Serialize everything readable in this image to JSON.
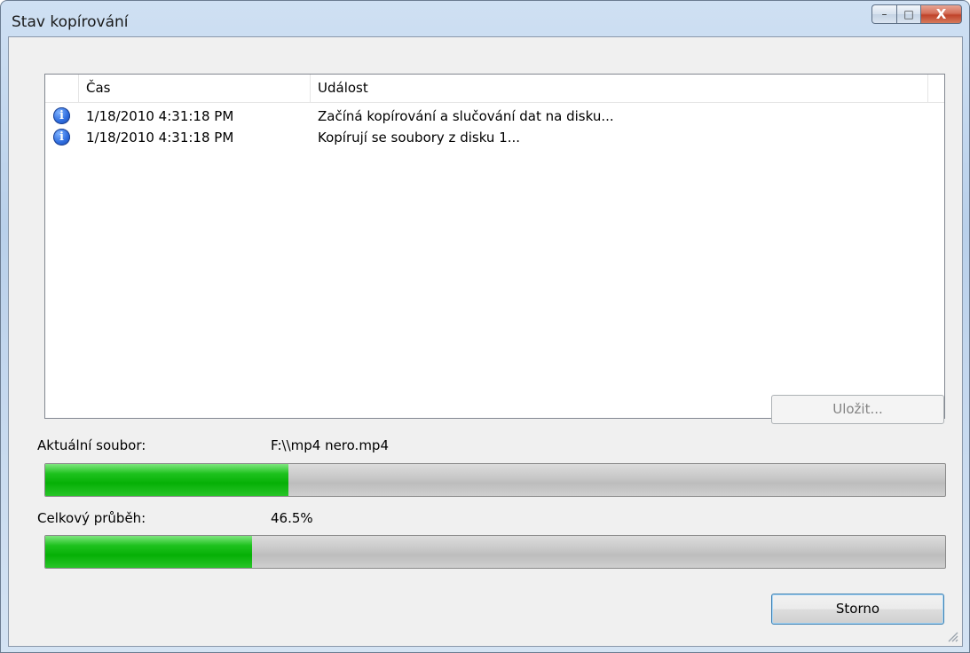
{
  "window": {
    "title": "Stav kopírování",
    "controls": {
      "minimize": "–",
      "maximize": "□",
      "close": "X"
    }
  },
  "log": {
    "columns": [
      "Čas",
      "Událost"
    ],
    "rows": [
      {
        "icon": "info-icon",
        "time": "1/18/2010 4:31:18 PM",
        "event": "Začíná kopírování a slučování dat na disku..."
      },
      {
        "icon": "info-icon",
        "time": "1/18/2010 4:31:18 PM",
        "event": "Kopírují se soubory z disku 1..."
      }
    ]
  },
  "buttons": {
    "save_label": "Uložit...",
    "cancel_label": "Storno"
  },
  "current_file": {
    "label": "Aktuální soubor:",
    "value": "F:\\\\mp4 nero.mp4",
    "progress_fraction": 0.27
  },
  "total": {
    "label": "Celkový průběh:",
    "value": "46.5%",
    "progress_fraction": 0.23
  },
  "colors": {
    "progress_fill": "#06b006",
    "accent": "#3c7fb1"
  }
}
